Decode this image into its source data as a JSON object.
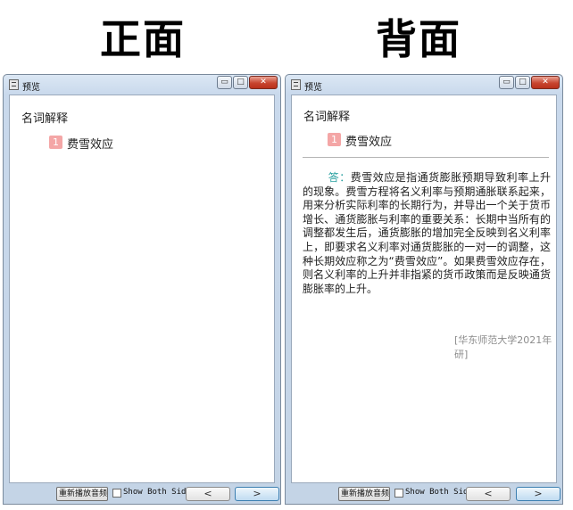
{
  "headings": {
    "front": "正面",
    "back": "背面"
  },
  "window": {
    "title": "预览",
    "controls": {
      "minimize": "▭",
      "maximize": "□",
      "close": "✕"
    }
  },
  "card": {
    "section_label": "名词解释",
    "number": "1",
    "term": "费雪效应",
    "answer_label": "答：",
    "answer_text": "费雪效应是指通货膨胀预期导致利率上升的现象。费雪方程将名义利率与预期通胀联系起来，用来分析实际利率的长期行为，并导出一个关于货币增长、通货膨胀与利率的重要关系：长期中当所有的调整都发生后，通货膨胀的增加完全反映到名义利率上，即要求名义利率对通货膨胀的一对一的调整，这种长期效应称之为“费雪效应”。如果费雪效应存在，则名义利率的上升并非指紧的货币政策而是反映通货膨胀率的上升。",
    "source": "[华东师范大学2021年研]"
  },
  "bottom_bar": {
    "replay_label": "重新播放音频",
    "show_both_label": "Show Both Sides",
    "show_both_checked": false,
    "prev_label": "<",
    "next_label": ">"
  }
}
